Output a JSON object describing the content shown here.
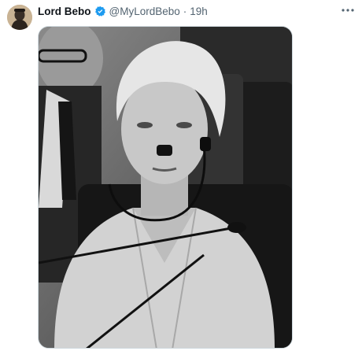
{
  "post": {
    "author_name": "Lord Bebo",
    "author_handle": "@MyLordBebo",
    "separator": "·",
    "timestamp": "19h",
    "verified": true
  },
  "media": {
    "image": "black-and-white photograph of a woman with headphones seated in a parliament chamber"
  },
  "icons": {
    "verified_badge": "verified-badge-icon",
    "more": "more-options-icon"
  },
  "colors": {
    "verified_blue": "#1d9bf0",
    "text_primary": "#0f1419",
    "text_secondary": "#536471"
  }
}
